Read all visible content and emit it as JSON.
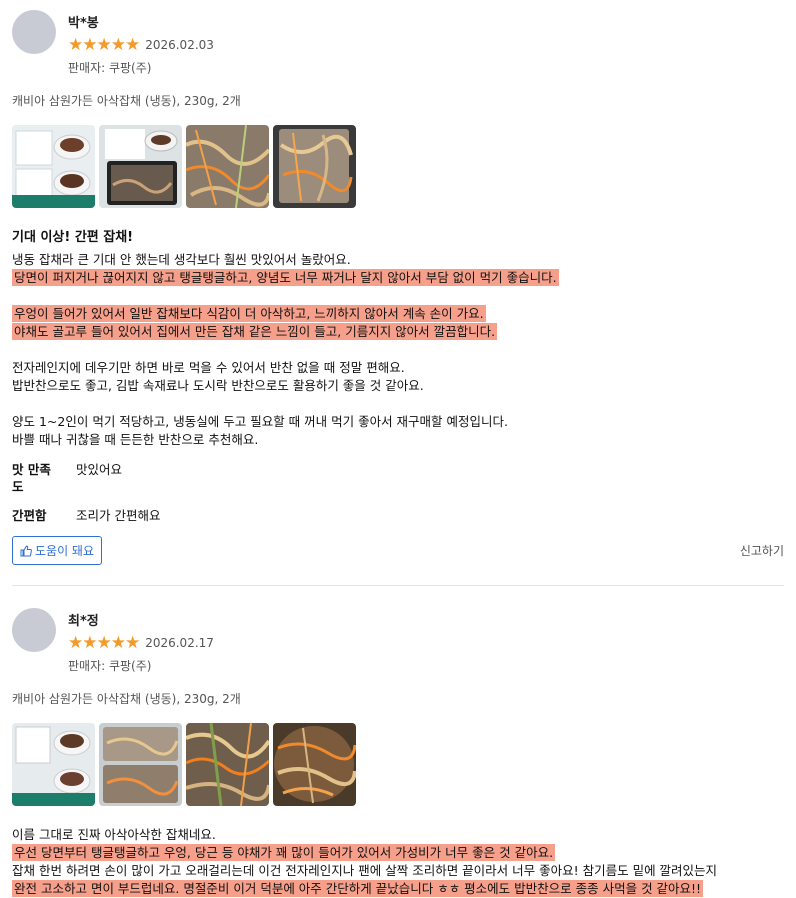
{
  "reviews": [
    {
      "name": "박*봉",
      "stars": "★★★★★",
      "rating": 5,
      "date": "2026.02.03",
      "seller": "판매자: 쿠팡(주)",
      "product": "캐비아 삼원가든 아삭잡채 (냉동), 230g, 2개",
      "title": "기대 이상! 간편 잡채!",
      "lines": [
        "냉동 잡채라 큰 기대 안 했는데 생각보다 훨씬 맛있어서 놀랐어요.",
        "당면이 퍼지거나 끊어지지 않고 탱글탱글하고, 양념도 너무 짜거나 달지 않아서 부담 없이 먹기 좋습니다.",
        "우엉이 들어가 있어서 일반 잡채보다 식감이 더 아삭하고, 느끼하지 않아서 계속 손이 가요.",
        "야채도 골고루 들어 있어서 집에서 만든 잡채 같은 느낌이 들고, 기름지지 않아서 깔끔합니다.",
        "전자레인지에 데우기만 하면 바로 먹을 수 있어서 반찬 없을 때 정말 편해요.",
        "밥반찬으로도 좋고, 김밥 속재료나 도시락 반찬으로도 활용하기 좋을 것 같아요.",
        "양도 1~2인이 먹기 적당하고, 냉동실에 두고 필요할 때 꺼내 먹기 좋아서 재구매할 예정입니다.",
        "바쁠 때나 귀찮을 때 든든한 반찬으로 추천해요."
      ],
      "attrs": [
        {
          "k": "맛 만족도",
          "v": "맛있어요"
        },
        {
          "k": "간편함",
          "v": "조리가 간편해요"
        }
      ],
      "helpful": "도움이 돼요",
      "report": "신고하기"
    },
    {
      "name": "최*정",
      "stars": "★★★★★",
      "rating": 5,
      "date": "2026.02.17",
      "seller": "판매자: 쿠팡(주)",
      "product": "캐비아 삼원가든 아삭잡채 (냉동), 230g, 2개",
      "lines": [
        "이름 그대로 진짜 아삭아삭한 잡채네요.",
        "우선 당면부터 탱글탱글하고 우엉, 당근 등 야채가 꽤 많이 들어가 있어서 가성비가 너무 좋은 것 같아요.",
        "잡채 한번 하려면 손이 많이 가고 오래걸리는데 이건 전자레인지나 팬에 살짝 조리하면 끝이라서 너무 좋아요! 참기름도 밑에 깔려있는지",
        "완전 고소하고 면이 부드럽네요. 명절준비 이거 덕분에 아주 간단하게 끝났습니다 ㅎㅎ 평소에도 밥반찬으로 종종 사먹을 것 같아요!!"
      ]
    }
  ]
}
